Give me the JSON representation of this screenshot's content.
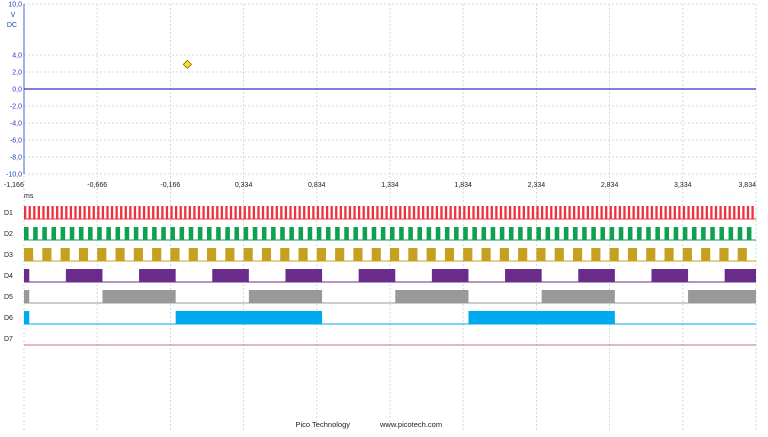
{
  "chart_data": {
    "type": "line",
    "title": "",
    "analog": {
      "unit": "V",
      "coupling": "DC",
      "ylim": [
        -10.0,
        10.0
      ],
      "y_ticks": [
        "10,0",
        "4,0",
        "2,0",
        "0,0",
        "-2,0",
        "-4,0",
        "-6,0",
        "-8,0",
        "-10,0"
      ],
      "y_tick_values": [
        10,
        4,
        2,
        0,
        -2,
        -4,
        -6,
        -8,
        -10
      ],
      "series": [
        {
          "name": "",
          "x": [
            -1.166,
            3.834
          ],
          "values": [
            0.0,
            0.0
          ]
        }
      ],
      "trigger_marker": {
        "x": -0.05,
        "y": 2.9
      }
    },
    "x": {
      "unit": "ms",
      "xlim": [
        -1.166,
        3.834
      ],
      "ticks": [
        "-1,166",
        "-0,666",
        "-0,166",
        "0,334",
        "0,834",
        "1,334",
        "1,834",
        "2,334",
        "2,834",
        "3,334",
        "3,834"
      ],
      "tick_values": [
        -1.166,
        -0.666,
        -0.166,
        0.334,
        0.834,
        1.334,
        1.834,
        2.334,
        2.834,
        3.334,
        3.834
      ]
    },
    "digital": [
      {
        "name": "D1",
        "color": "#f0303c",
        "period": 0.03125,
        "first_rise": -1.166,
        "duty": 0.5
      },
      {
        "name": "D2",
        "color": "#10a050",
        "period": 0.0625,
        "first_rise": -1.166,
        "duty": 0.5
      },
      {
        "name": "D3",
        "color": "#c8a020",
        "period": 0.125,
        "first_rise": -1.166,
        "duty": 0.5
      },
      {
        "name": "D4",
        "color": "#6a2c8a",
        "period": 0.5,
        "first_rise": -0.88,
        "duty": 0.5
      },
      {
        "name": "D5",
        "color": "#999999",
        "period": 1.0,
        "first_rise": -0.63,
        "duty": 0.5
      },
      {
        "name": "D6",
        "color": "#00aaee",
        "period": 2.0,
        "first_rise": -0.13,
        "duty": 0.5
      },
      {
        "name": "D7",
        "color": "#d06a9a",
        "period": 0,
        "first_rise": 0,
        "duty": 0
      }
    ]
  },
  "footer": {
    "brand": "Pico Technology",
    "url": "www.picotech.com"
  }
}
